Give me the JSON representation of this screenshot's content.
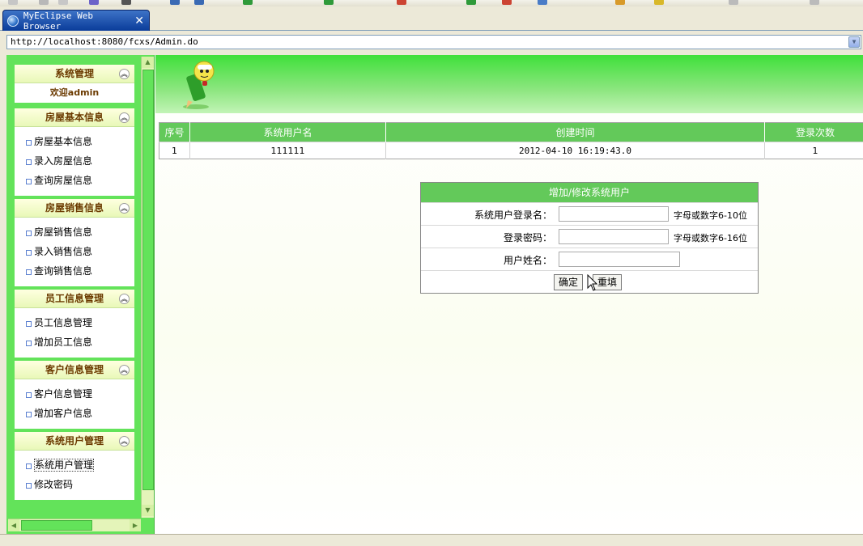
{
  "tab": {
    "title": "MyEclipse Web Browser"
  },
  "address": {
    "url": "http://localhost:8080/fcxs/Admin.do"
  },
  "sidebar": {
    "panels": [
      {
        "title": "系统管理",
        "welcome": "欢迎admin",
        "items": []
      },
      {
        "title": "房屋基本信息",
        "items": [
          "房屋基本信息",
          "录入房屋信息",
          "查询房屋信息"
        ]
      },
      {
        "title": "房屋销售信息",
        "items": [
          "房屋销售信息",
          "录入销售信息",
          "查询销售信息"
        ]
      },
      {
        "title": "员工信息管理",
        "items": [
          "员工信息管理",
          "增加员工信息"
        ]
      },
      {
        "title": "客户信息管理",
        "items": [
          "客户信息管理",
          "增加客户信息"
        ]
      },
      {
        "title": "系统用户管理",
        "items": [
          "系统用户管理",
          "修改密码"
        ]
      }
    ]
  },
  "user_table": {
    "headers": [
      "序号",
      "系统用户名",
      "创建时间",
      "登录次数"
    ],
    "rows": [
      [
        "1",
        "111111",
        "2012-04-10 16:19:43.0",
        "1"
      ]
    ]
  },
  "form": {
    "title": "增加/修改系统用户",
    "login_label": "系统用户登录名：",
    "login_hint": "字母或数字6-10位",
    "password_label": "登录密码：",
    "password_hint": "字母或数字6-16位",
    "name_label": "用户姓名：",
    "confirm_label": "确定",
    "reset_label": "重填"
  },
  "colors": {
    "sidebar_green": "#63e35a",
    "header_green": "#63c95a"
  }
}
